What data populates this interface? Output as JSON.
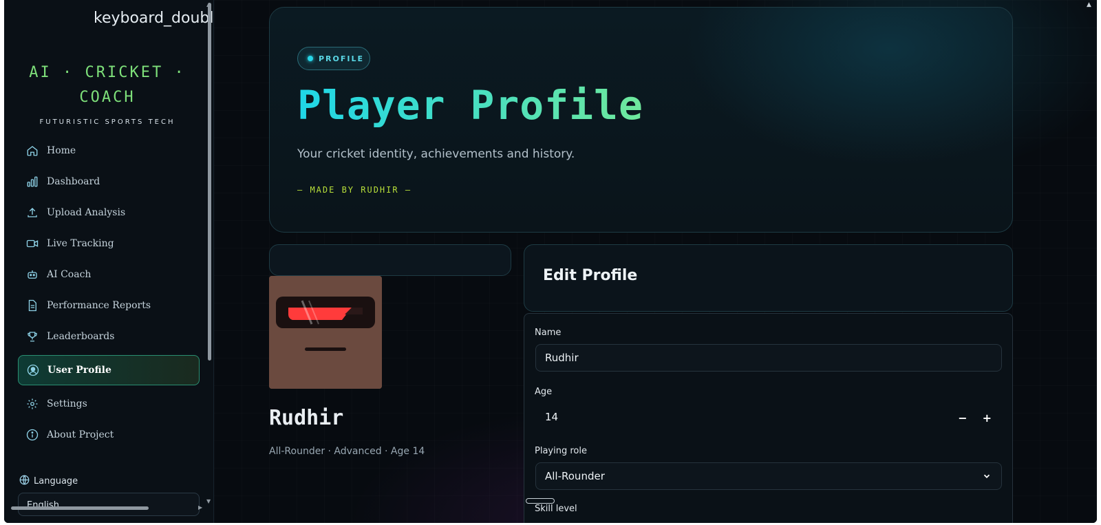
{
  "sidebar": {
    "toggle_label": "keyboard_double",
    "brand_title": "AI · CRICKET · COACH",
    "brand_subtitle": "FUTURISTIC SPORTS TECH",
    "items": [
      {
        "label": "Home",
        "icon": "home-icon"
      },
      {
        "label": "Dashboard",
        "icon": "bar-chart-icon"
      },
      {
        "label": "Upload Analysis",
        "icon": "upload-icon"
      },
      {
        "label": "Live Tracking",
        "icon": "video-icon"
      },
      {
        "label": "AI Coach",
        "icon": "robot-icon"
      },
      {
        "label": "Performance Reports",
        "icon": "document-icon"
      },
      {
        "label": "Leaderboards",
        "icon": "trophy-icon"
      },
      {
        "label": "User Profile",
        "icon": "user-circle-icon",
        "active": true
      },
      {
        "label": "Settings",
        "icon": "gear-icon"
      },
      {
        "label": "About Project",
        "icon": "info-icon"
      }
    ],
    "language_label": "Language",
    "language_value": "English"
  },
  "hero": {
    "badge": "PROFILE",
    "title": "Player Profile",
    "subtitle": "Your cricket identity, achievements and history.",
    "made_by": "— MADE BY RUDHIR —"
  },
  "player": {
    "name": "Rudhir",
    "meta": "All-Rounder · Advanced · Age 14"
  },
  "edit_profile": {
    "title": "Edit Profile",
    "name_label": "Name",
    "name_value": "Rudhir",
    "age_label": "Age",
    "age_value": "14",
    "decrement": "−",
    "increment": "+",
    "role_label": "Playing role",
    "role_value": "All-Rounder",
    "skill_label": "Skill level"
  },
  "colors": {
    "accent_cyan": "#1fd6e8",
    "accent_green": "#6fe89c",
    "brand_green": "#7ee07a",
    "made_by_lime": "#b9e03a",
    "avatar_bg": "#6b4a3f",
    "visor_red": "#ff3b3b"
  }
}
